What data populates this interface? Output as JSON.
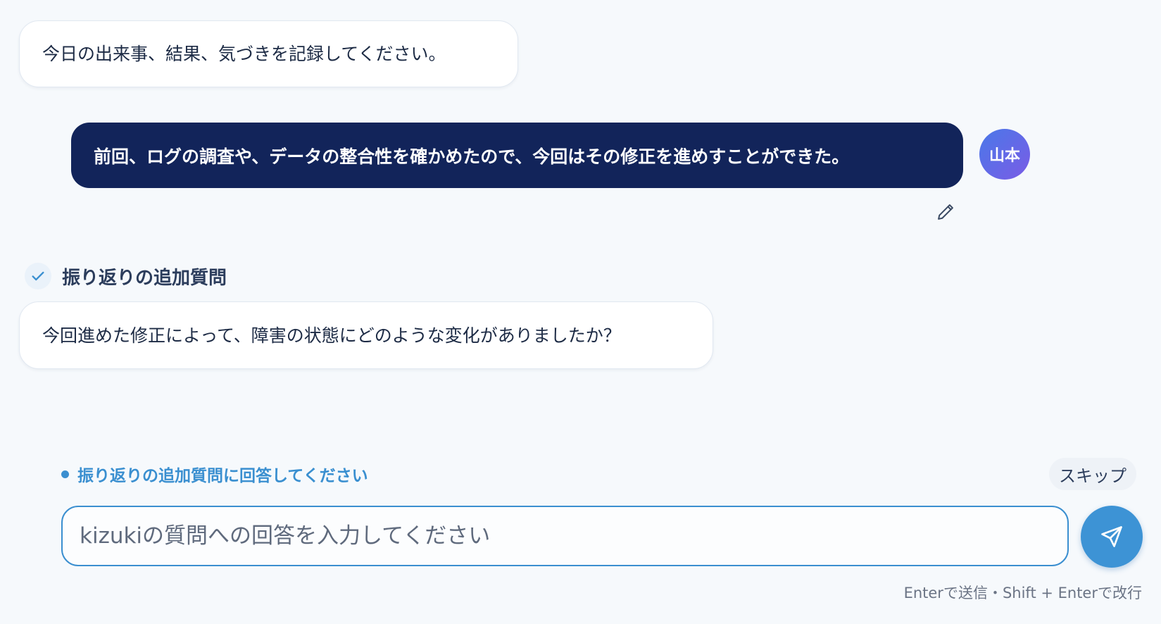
{
  "conversation": {
    "prompt": "今日の出来事、結果、気づきを記録してください。",
    "user_message": "前回、ログの調査や、データの整合性を確かめたので、今回はその修正を進めすことができた。",
    "user_avatar": "山本",
    "edit_icon": "pencil-icon",
    "section": {
      "icon": "check-icon",
      "title": "振り返りの追加質問"
    },
    "followup_question": "今回進めた修正によって、障害の状態にどのような変化がありましたか？"
  },
  "composer": {
    "hint": "振り返りの追加質問に回答してください",
    "skip_label": "スキップ",
    "input_value": "",
    "input_placeholder": "kizukiの質問への回答を入力してください",
    "send_icon": "send-icon",
    "shortcut_hint": "Enterで送信・Shift + Enterで改行"
  },
  "colors": {
    "background": "#f6f9fc",
    "user_bubble": "#12245a",
    "accent": "#3d93d5",
    "avatar_gradient_start": "#4a78e8",
    "avatar_gradient_end": "#7a5ce6"
  }
}
